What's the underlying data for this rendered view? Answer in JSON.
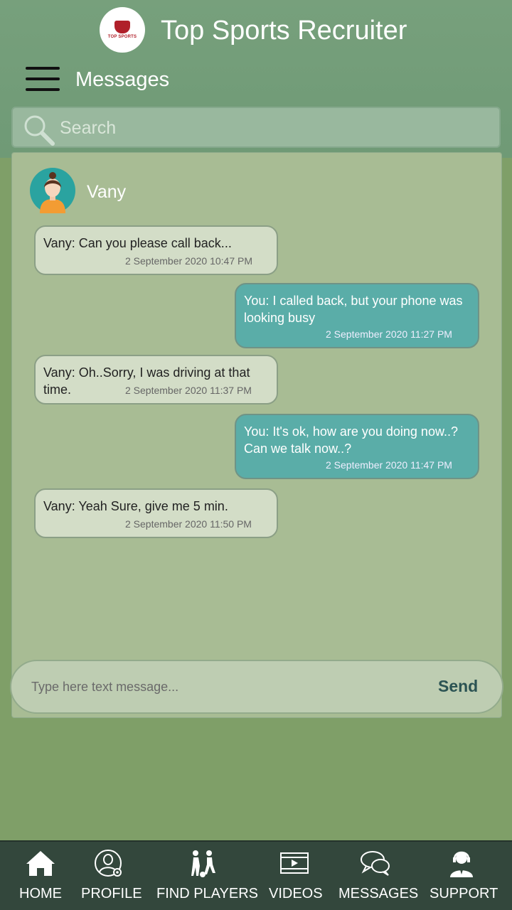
{
  "app": {
    "title": "Top Sports Recruiter",
    "logo_text": "TOP SPORTS"
  },
  "page": {
    "title": "Messages"
  },
  "search": {
    "placeholder": "Search"
  },
  "contact": {
    "name": "Vany"
  },
  "messages": [
    {
      "direction": "in",
      "text": "Vany: Can you please call back...",
      "time": "2 September 2020  10:47 PM"
    },
    {
      "direction": "out",
      "text": "You: I called back, but your phone was looking busy",
      "time": "2 September 2020  11:27 PM"
    },
    {
      "direction": "in",
      "text": "Vany: Oh..Sorry, I was driving at that time.",
      "time": "2 September 2020  11:37 PM"
    },
    {
      "direction": "out",
      "text": "You: It's ok, how are you doing now..? Can we talk now..?",
      "time": "2 September 2020  11:47 PM"
    },
    {
      "direction": "in",
      "text": "Vany: Yeah Sure, give me 5 min.",
      "time": "2 September 2020  11:50 PM"
    }
  ],
  "compose": {
    "placeholder": "Type here text message...",
    "send_label": "Send"
  },
  "nav": [
    {
      "label": "HOME",
      "icon": "home-icon"
    },
    {
      "label": "PROFILE",
      "icon": "profile-settings-icon"
    },
    {
      "label": "FIND PLAYERS",
      "icon": "players-icon"
    },
    {
      "label": "VIDEOS",
      "icon": "video-icon"
    },
    {
      "label": "MESSAGES",
      "icon": "chat-icon"
    },
    {
      "label": "SUPPORT",
      "icon": "support-agent-icon"
    }
  ],
  "colors": {
    "header": "#6f9a76",
    "background": "#7f9f68",
    "incoming_bubble": "#d3ddc7",
    "outgoing_bubble": "#5aada8",
    "nav_bar": "#33473c",
    "send": "#2b5353"
  }
}
